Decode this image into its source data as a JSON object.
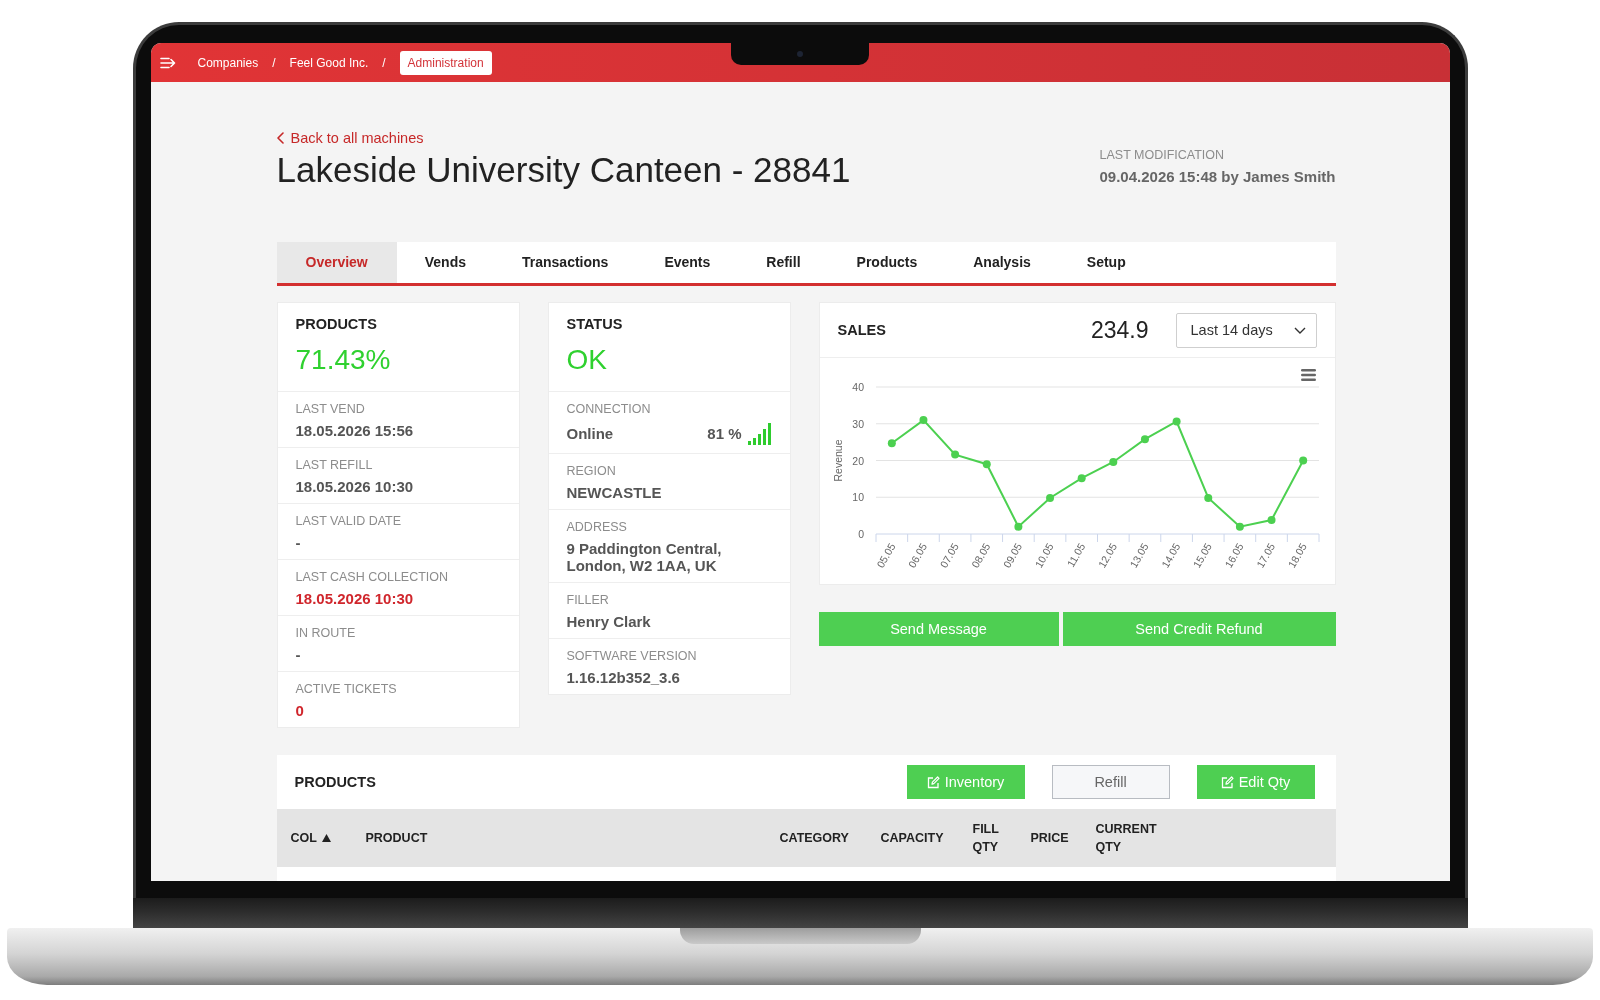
{
  "topbar": {
    "breadcrumbs": [
      {
        "label": "Companies",
        "selected": false
      },
      {
        "separator": "/",
        "label": "Feel Good Inc.",
        "selected": false
      },
      {
        "separator": "/",
        "label": "Administration",
        "selected": true
      }
    ]
  },
  "header": {
    "back_link": "Back to all machines",
    "title": "Lakeside University Canteen - 28841",
    "last_modification": {
      "label": "LAST MODIFICATION",
      "value": "09.04.2026 15:48 by James Smith"
    }
  },
  "tabs": [
    {
      "label": "Overview",
      "selected": true
    },
    {
      "label": "Vends",
      "selected": false
    },
    {
      "label": "Transactions",
      "selected": false
    },
    {
      "label": "Events",
      "selected": false
    },
    {
      "label": "Refill",
      "selected": false
    },
    {
      "label": "Products",
      "selected": false
    },
    {
      "label": "Analysis",
      "selected": false
    },
    {
      "label": "Setup",
      "selected": false
    }
  ],
  "products_card": {
    "title": "PRODUCTS",
    "value": "71.43%",
    "rows": [
      {
        "label": "LAST VEND",
        "value": "18.05.2026 15:56",
        "alert": false
      },
      {
        "label": "LAST REFILL",
        "value": "18.05.2026 10:30",
        "alert": false
      },
      {
        "label": "LAST VALID DATE",
        "value": "-",
        "alert": false
      },
      {
        "label": "LAST CASH COLLECTION",
        "value": "18.05.2026 10:30",
        "alert": true
      },
      {
        "label": "IN ROUTE",
        "value": "-",
        "alert": false
      },
      {
        "label": "ACTIVE TICKETS",
        "value": "0",
        "alert": true
      }
    ]
  },
  "status_card": {
    "title": "STATUS",
    "value": "OK",
    "rows": [
      {
        "kind": "connection",
        "label": "CONNECTION",
        "value": "Online",
        "reading": "81 %"
      },
      {
        "kind": "text",
        "label": "REGION",
        "value": "NEWCASTLE"
      },
      {
        "kind": "text",
        "label": "ADDRESS",
        "value": "9 Paddington Central,\nLondon, W2 1AA, UK"
      },
      {
        "kind": "text",
        "label": "FILLER",
        "value": "Henry Clark"
      },
      {
        "kind": "text",
        "label": "SOFTWARE VERSION",
        "value": "1.16.12b352_3.6"
      }
    ]
  },
  "sales_card": {
    "title": "SALES",
    "total": "234.9",
    "period": "Last 14 days",
    "chart_data": {
      "type": "line",
      "ylabel": "Revenue",
      "categories": [
        "05.05",
        "06.05",
        "07.05",
        "08.05",
        "09.05",
        "10.05",
        "11.05",
        "12.05",
        "13.05",
        "14.05",
        "15.05",
        "16.05",
        "17.05",
        "18.05"
      ],
      "series": [
        {
          "color": "#4cd050",
          "marker": "circle",
          "values": [
            24.7,
            31,
            21.6,
            19,
            2,
            9.8,
            15.2,
            19.6,
            25.8,
            30.6,
            9.8,
            2,
            3.8,
            20
          ]
        }
      ],
      "ylim": [
        0,
        40
      ],
      "yticks": [
        0,
        10,
        20,
        30,
        40
      ],
      "grid": true
    }
  },
  "actions": [
    "Send Message",
    "Send Credit Refund"
  ],
  "products_table": {
    "title": "PRODUCTS",
    "buttons": [
      {
        "label": "Inventory",
        "kind": "primary"
      },
      {
        "label": "Refill",
        "kind": "secondary"
      },
      {
        "label": "Edit Qty",
        "kind": "primary"
      }
    ],
    "columns": [
      {
        "label": "COL",
        "sorted": true
      },
      {
        "label": "PRODUCT",
        "sorted": false
      },
      {
        "label": "CATEGORY",
        "sorted": false
      },
      {
        "label": "CAPACITY",
        "sorted": false
      },
      {
        "label": "FILL QTY",
        "sorted": false
      },
      {
        "label": "PRICE",
        "sorted": false
      },
      {
        "label": "CURRENT QTY",
        "sorted": false
      }
    ]
  }
}
